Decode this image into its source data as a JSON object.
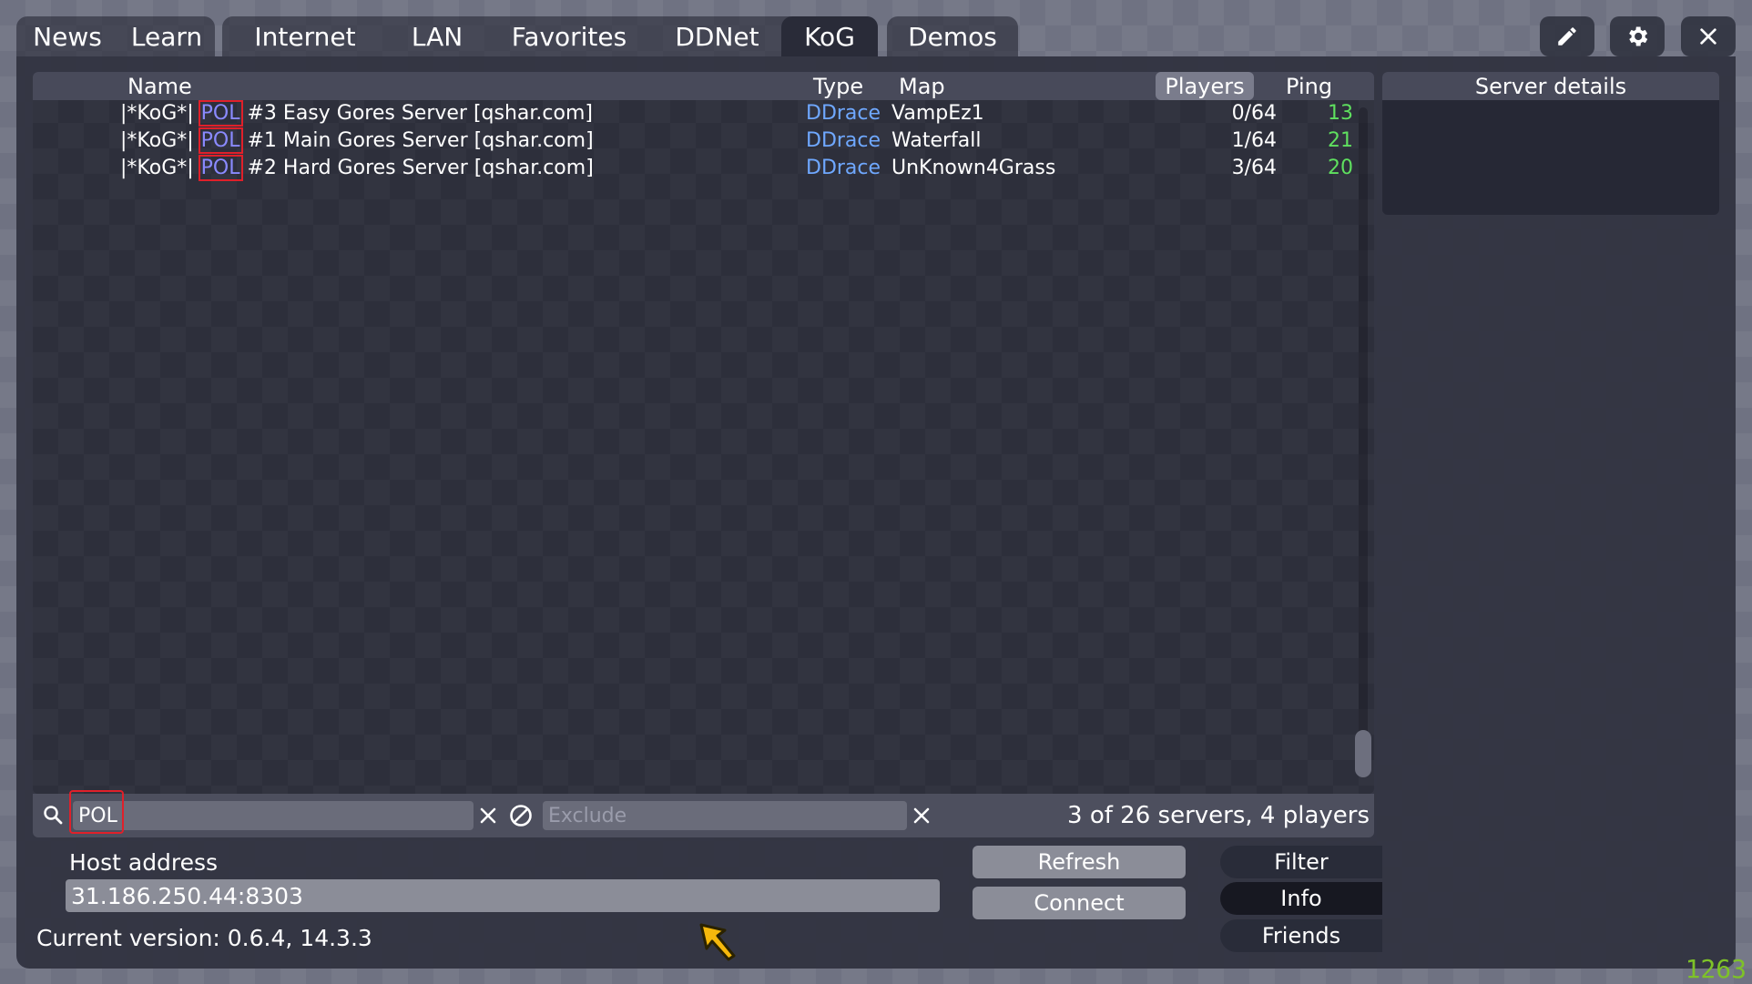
{
  "tabs": {
    "news": "News",
    "learn": "Learn",
    "internet": "Internet",
    "lan": "LAN",
    "favorites": "Favorites",
    "ddnet": "DDNet",
    "kog": "KoG",
    "demos": "Demos"
  },
  "columns": {
    "name": "Name",
    "type": "Type",
    "map": "Map",
    "players": "Players",
    "ping": "Ping"
  },
  "servers": [
    {
      "prefix": "|*KoG*| ",
      "highlight": "POL",
      "rest": " #3 Easy Gores Server [qshar.com]",
      "type": "DDrace",
      "map": "VampEz1",
      "players": "0/64",
      "ping": "13"
    },
    {
      "prefix": "|*KoG*| ",
      "highlight": "POL",
      "rest": " #1 Main Gores Server [qshar.com]",
      "type": "DDrace",
      "map": "Waterfall",
      "players": "1/64",
      "ping": "21"
    },
    {
      "prefix": "|*KoG*| ",
      "highlight": "POL",
      "rest": " #2 Hard Gores Server [qshar.com]",
      "type": "DDrace",
      "map": "UnKnown4Grass",
      "players": "3/64",
      "ping": "20"
    }
  ],
  "details": {
    "title": "Server details"
  },
  "search": {
    "value": "POL",
    "exclude_placeholder": "Exclude",
    "summary": "3 of 26 servers, 4 players"
  },
  "host": {
    "label": "Host address",
    "value": "31.186.250.44:8303"
  },
  "buttons": {
    "refresh": "Refresh",
    "connect": "Connect"
  },
  "sidetabs": {
    "filter": "Filter",
    "info": "Info",
    "friends": "Friends"
  },
  "version": "Current version: 0.6.4, 14.3.3",
  "fps": "1263",
  "icons": {
    "edit": "pencil-icon",
    "settings": "gear-icon",
    "close": "close-icon",
    "search": "search-icon",
    "clear": "clear-icon",
    "exclude": "no-entry-icon",
    "cursor": "cursor-arrow-icon"
  },
  "colors": {
    "highlight": "#8a8aff",
    "type": "#6fa8ff",
    "ping_good": "#5fe05f",
    "annotation": "#e0202a",
    "fps": "#7ec228"
  }
}
